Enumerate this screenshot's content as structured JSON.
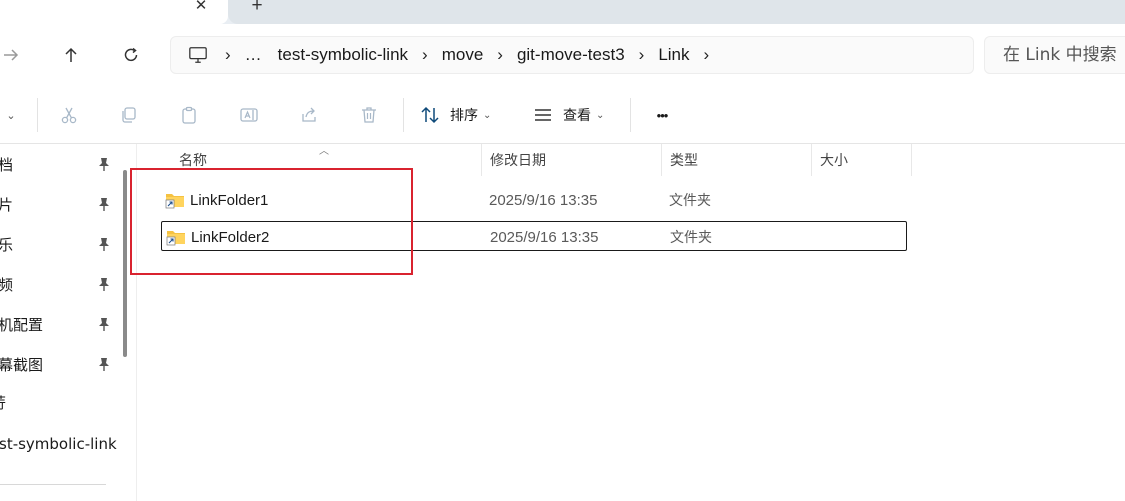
{
  "tabs": {
    "close_glyph": "✕",
    "new_glyph": "+"
  },
  "navigation": {
    "breadcrumb": [
      "…",
      "test-symbolic-link",
      "move",
      "git-move-test3",
      "Link"
    ],
    "search_placeholder": "在 Link 中搜索"
  },
  "toolbar": {
    "sort_label": "排序",
    "view_label": "查看",
    "more_glyph": "•••"
  },
  "sidebar": {
    "items": [
      {
        "label": "档",
        "pinned": true
      },
      {
        "label": "片",
        "pinned": true
      },
      {
        "label": "乐",
        "pinned": true
      },
      {
        "label": "频",
        "pinned": true
      },
      {
        "label": "机配置",
        "pinned": true
      },
      {
        "label": "幕截图",
        "pinned": true
      },
      {
        "label": "荇",
        "pinned": false
      },
      {
        "label": "st-symbolic-link",
        "pinned": false
      }
    ]
  },
  "file_list": {
    "columns": {
      "name": "名称",
      "modified": "修改日期",
      "type": "类型",
      "size": "大小"
    },
    "rows": [
      {
        "name": "LinkFolder1",
        "modified": "2025/9/16 13:35",
        "type": "文件夹",
        "size": "",
        "selected": false
      },
      {
        "name": "LinkFolder2",
        "modified": "2025/9/16 13:35",
        "type": "文件夹",
        "size": "",
        "selected": true
      }
    ]
  },
  "colors": {
    "highlight": "#d9232f",
    "folder": "#f5c242",
    "accent": "#0067c0"
  }
}
